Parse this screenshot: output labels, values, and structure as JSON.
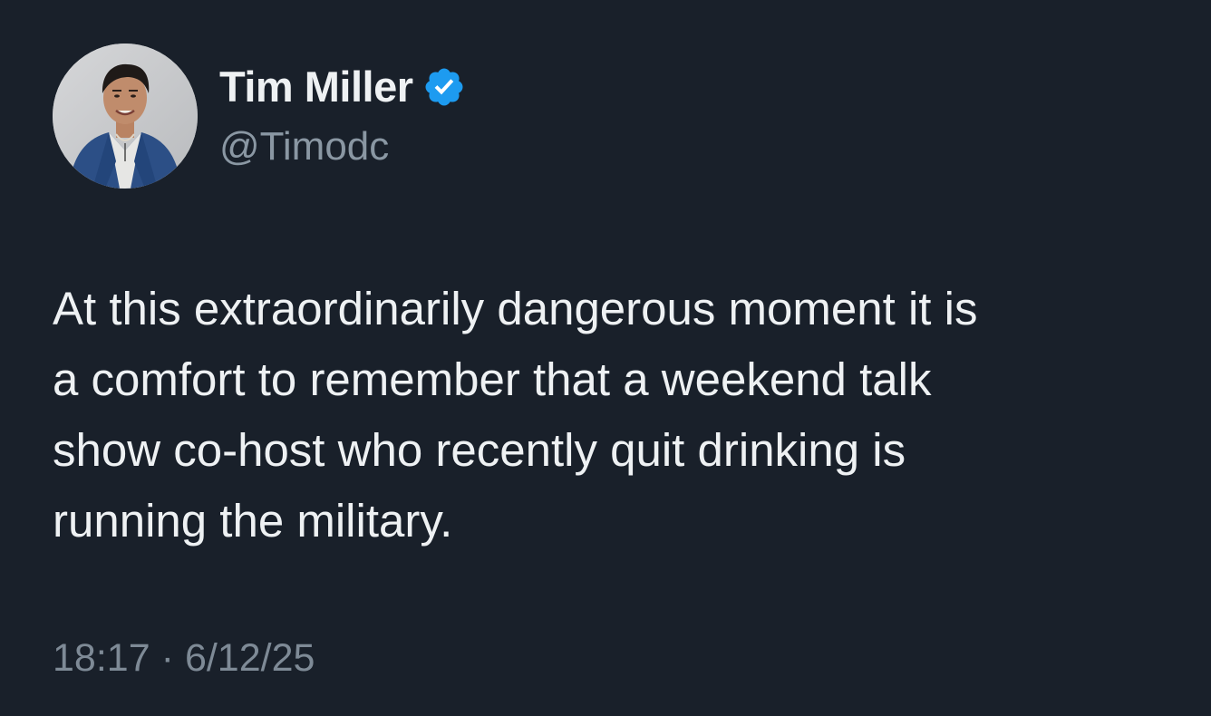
{
  "author": {
    "display_name": "Tim Miller",
    "handle": "@Timodc",
    "verified": true,
    "avatar_icon": "user-photo",
    "verified_icon": "verified-badge-icon",
    "verified_color": "#1d9bf0"
  },
  "tweet": {
    "text": "At this extraordinarily dangerous moment it is\na comfort to remember that a weekend talk\nshow co-host who recently quit drinking is\nrunning the military.",
    "time": "18:17",
    "separator": "·",
    "date": "6/12/25"
  },
  "colors": {
    "background": "#19202a",
    "text": "#eef1f3",
    "muted": "#8a97a3"
  }
}
